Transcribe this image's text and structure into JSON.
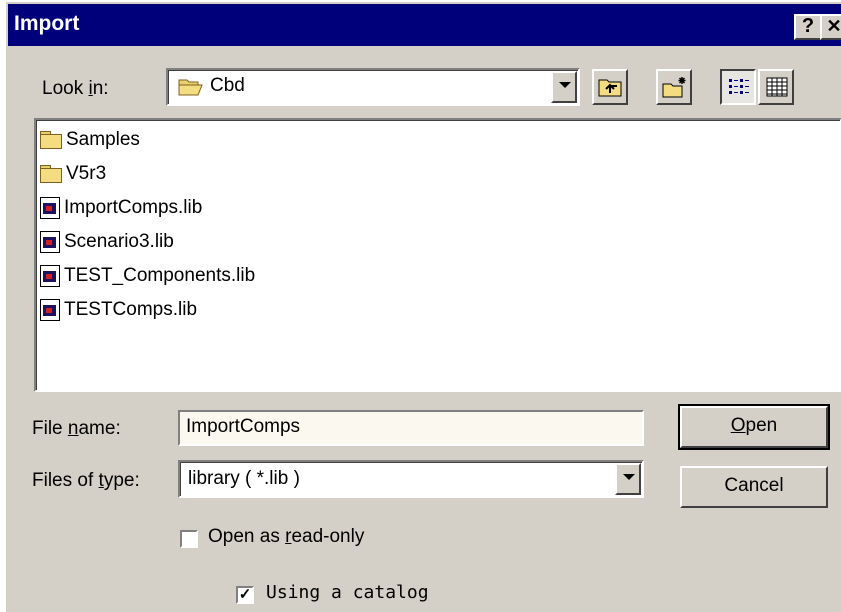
{
  "window": {
    "title": "Import",
    "help_glyph": "?",
    "close_glyph": "✕"
  },
  "look_in": {
    "label_pre": "Look ",
    "label_key": "i",
    "label_post": "n:",
    "value": "Cbd",
    "folder_icon": "open-folder-icon"
  },
  "toolbar": {
    "icons": [
      "up-one-level-icon",
      "create-new-folder-icon",
      "list-view-icon",
      "details-view-icon"
    ]
  },
  "files": [
    {
      "name": "Samples",
      "icon": "folder-icon"
    },
    {
      "name": "V5r3",
      "icon": "folder-icon"
    },
    {
      "name": "ImportComps.lib",
      "icon": "library-file-icon"
    },
    {
      "name": "Scenario3.lib",
      "icon": "library-file-icon"
    },
    {
      "name": "TEST_Components.lib",
      "icon": "library-file-icon"
    },
    {
      "name": "TESTComps.lib",
      "icon": "library-file-icon"
    }
  ],
  "file_name": {
    "label_pre": "File ",
    "label_key": "n",
    "label_post": "ame:",
    "value": "ImportComps"
  },
  "file_type": {
    "label_pre": "Files of ",
    "label_key": "t",
    "label_post": "ype:",
    "value": "library ( *.lib )"
  },
  "buttons": {
    "open_key": "O",
    "open_rest": "pen",
    "cancel": "Cancel"
  },
  "read_only": {
    "label_pre": "Open as ",
    "label_key": "r",
    "label_post": "ead-only",
    "checked": false
  },
  "catalog": {
    "label": "Using a catalog",
    "checked": true,
    "check_glyph": "✓"
  }
}
